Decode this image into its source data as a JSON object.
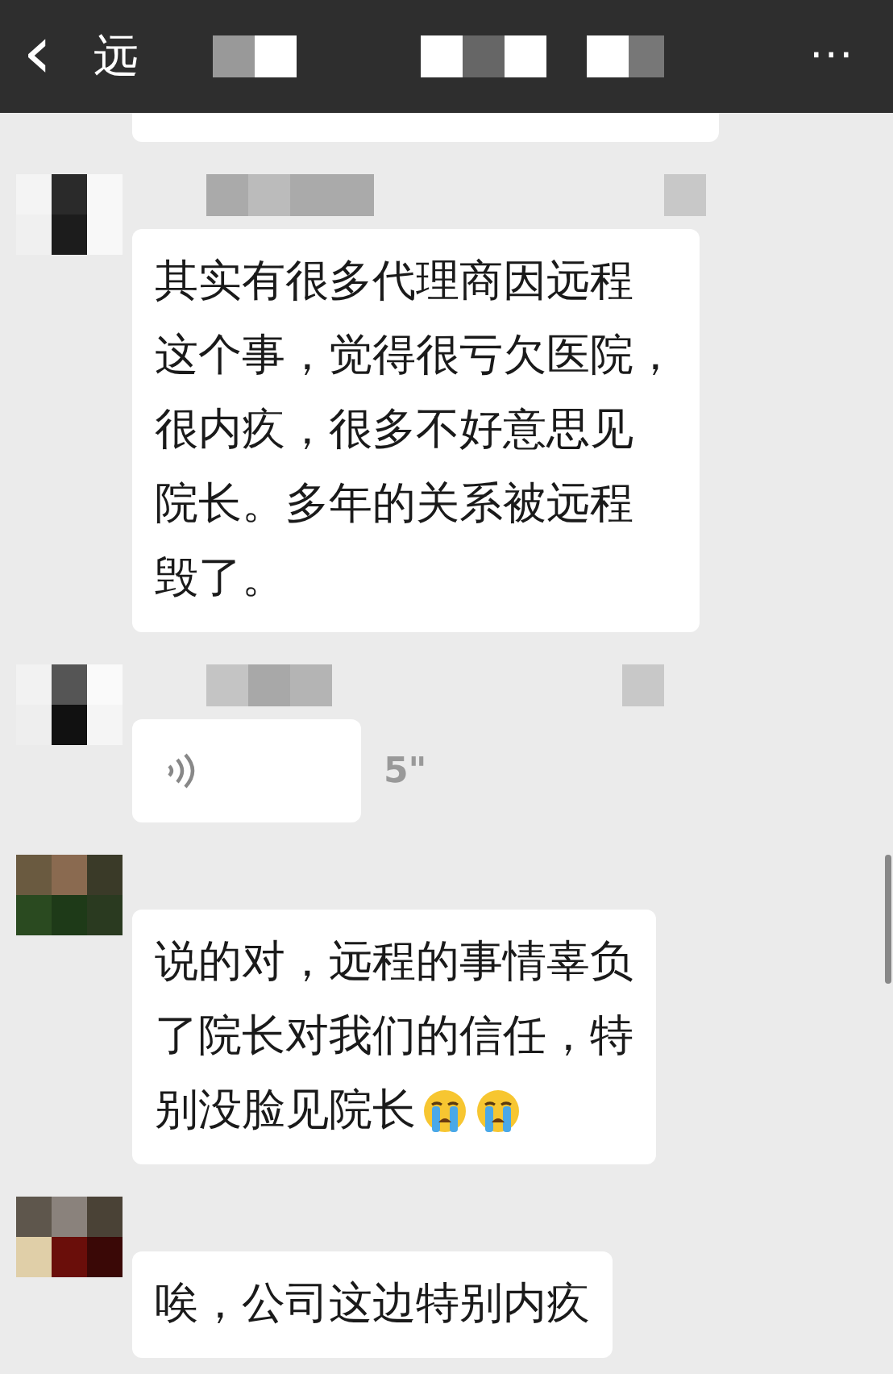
{
  "header": {
    "back": "‹",
    "title": "远",
    "more": "···"
  },
  "messages": [
    {
      "kind": "text",
      "lines": [
        "其实有很多代理商因远程",
        "这个事，觉得很亏欠医院，",
        "很内疚，很多不好意思见",
        "院长。多年的关系被远程",
        "毁了。"
      ]
    },
    {
      "kind": "voice",
      "duration": "5\""
    },
    {
      "kind": "text",
      "lines": [
        "说的对，远程的事情辜负",
        "了院长对我们的信任，特",
        "别没脸见院长"
      ],
      "stickers": [
        {
          "kind": "crying"
        },
        {
          "kind": "crying"
        }
      ]
    },
    {
      "kind": "text",
      "lines": [
        "唉，公司这边特别内疚"
      ]
    }
  ]
}
